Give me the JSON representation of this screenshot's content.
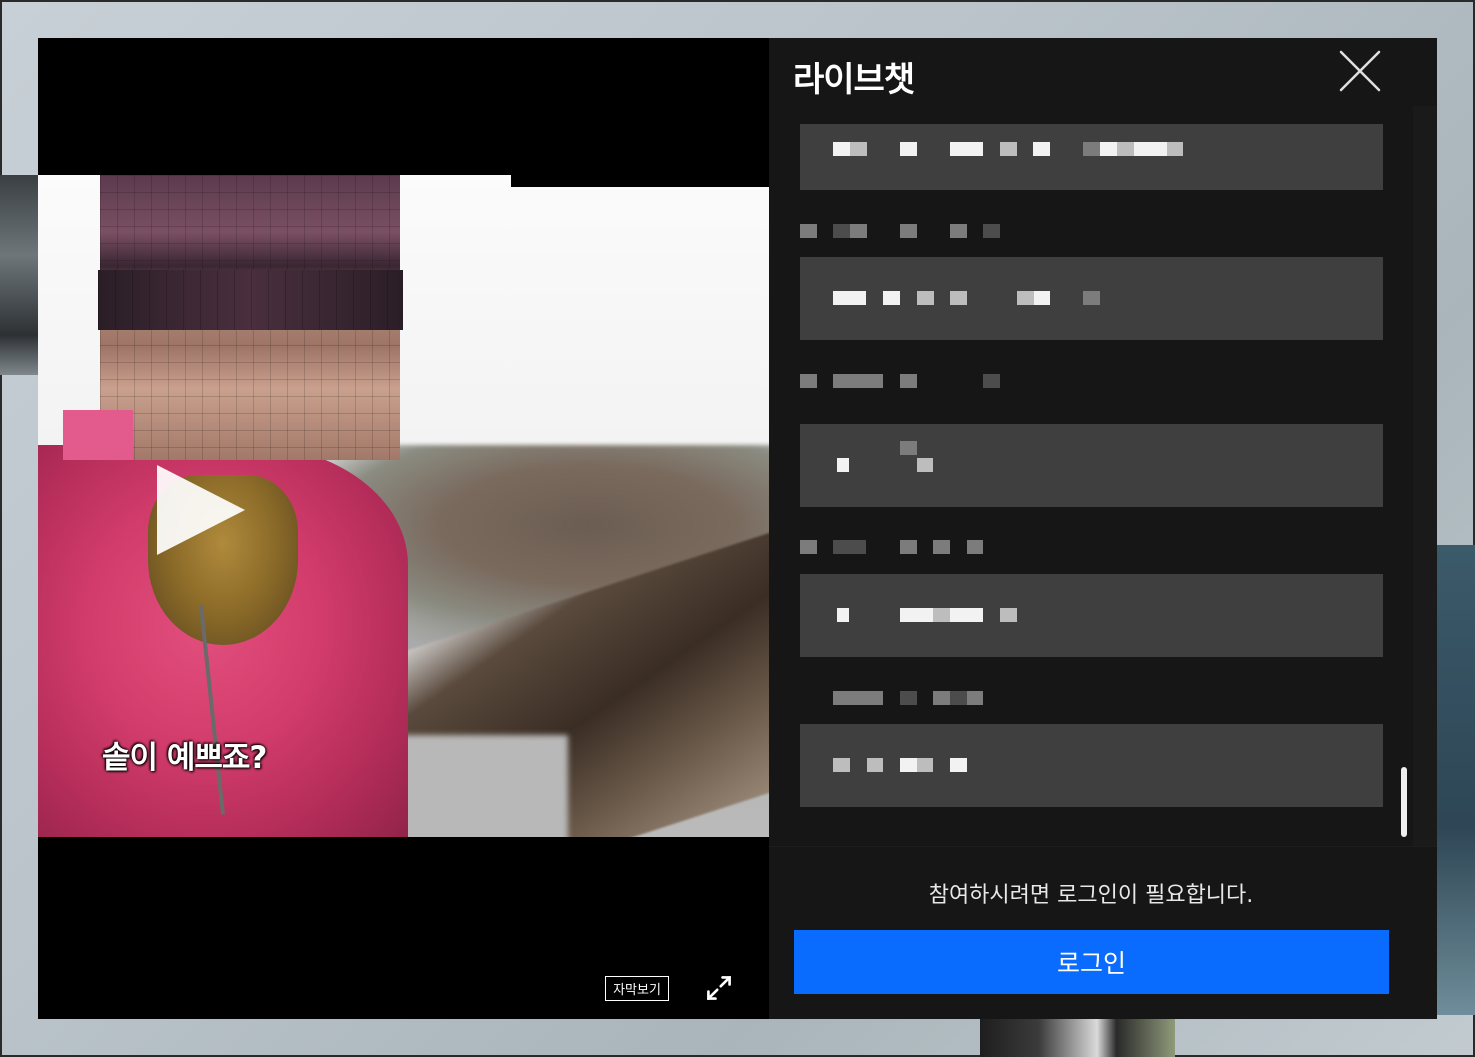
{
  "video": {
    "subtitle_text": "솥이 예쁘죠?",
    "caption_button_label": "자막보기",
    "play_icon": "play-icon",
    "fullscreen_icon": "expand-arrows-icon"
  },
  "chat": {
    "title": "라이브챗",
    "close_icon": "close-icon",
    "login_prompt": "참여하시려면 로그인이 필요합니다.",
    "login_button_label": "로그인"
  },
  "colors": {
    "login_button": "#0a6cff",
    "chat_bg": "#161616",
    "message_bubble": "#3f3f3f"
  }
}
